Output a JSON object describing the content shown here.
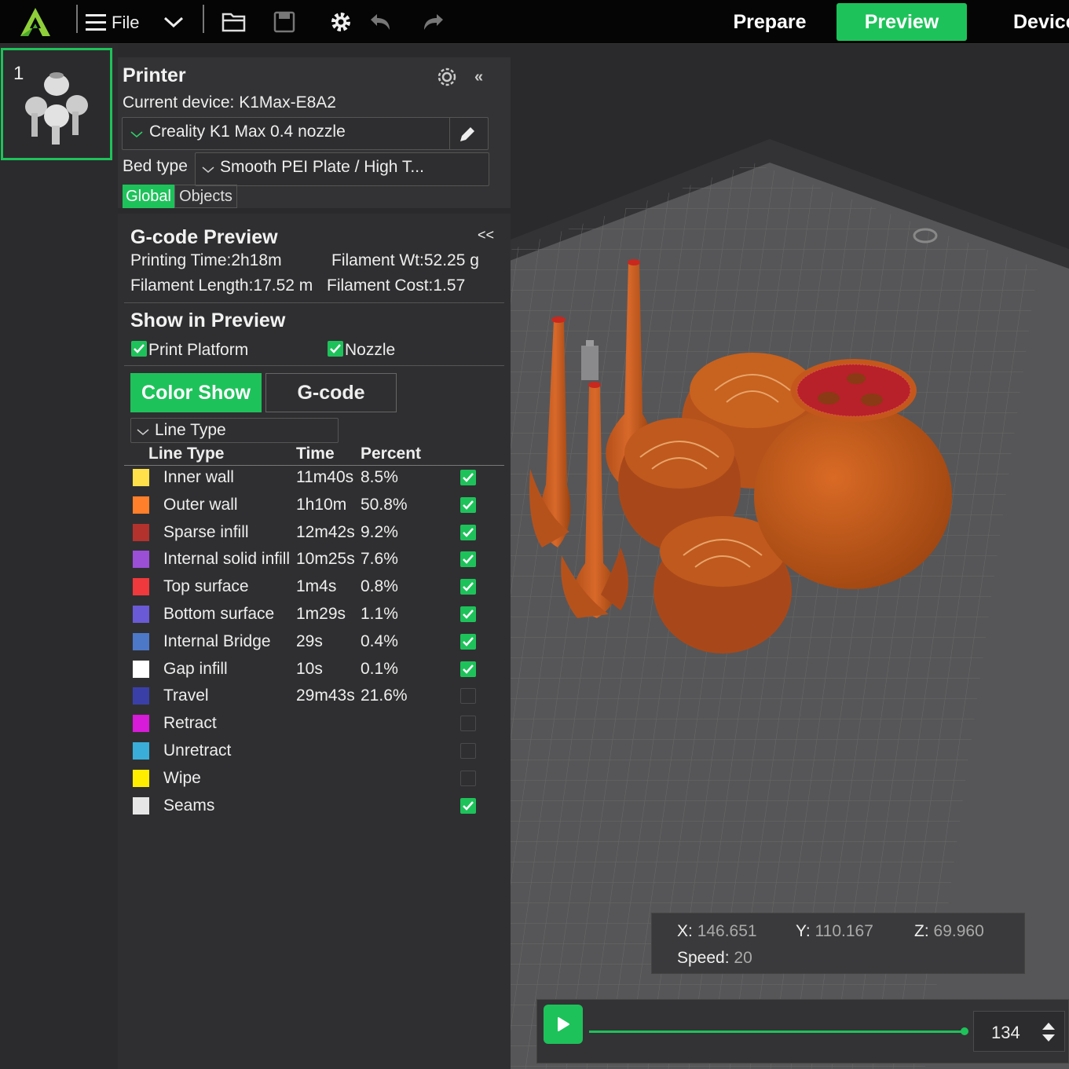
{
  "toolbar": {
    "file_label": "File",
    "nav_prepare": "Prepare",
    "nav_preview": "Preview",
    "nav_device": "Device"
  },
  "plate": {
    "number": "1"
  },
  "printer": {
    "title": "Printer",
    "current_device": "Current device: K1Max-E8A2",
    "printer_profile": "Creality K1 Max 0.4 nozzle",
    "bed_type_label": "Bed type",
    "bed_type_value": "Smooth PEI Plate / High T...",
    "tab_global": "Global",
    "tab_objects": "Objects"
  },
  "gcode_preview": {
    "title": "G-code Preview",
    "collapse_label": "<<",
    "printing_time": "Printing Time:2h18m",
    "filament_wt": "Filament Wt:52.25 g",
    "filament_length": "Filament Length:17.52 m",
    "filament_cost": "Filament Cost:1.57",
    "show_title": "Show in Preview",
    "print_platform": "Print Platform",
    "nozzle": "Nozzle",
    "color_show": "Color Show",
    "gcode_btn": "G-code",
    "view_mode": "Line Type",
    "col_line_type": "Line Type",
    "col_time": "Time",
    "col_percent": "Percent",
    "line_types": [
      {
        "name": "Inner wall",
        "time": "11m40s",
        "percent": "8.5%",
        "color": "#ffe04a",
        "checked": true
      },
      {
        "name": "Outer wall",
        "time": "1h10m",
        "percent": "50.8%",
        "color": "#ff7f2a",
        "checked": true
      },
      {
        "name": "Sparse infill",
        "time": "12m42s",
        "percent": "9.2%",
        "color": "#b3322d",
        "checked": true
      },
      {
        "name": "Internal solid infill",
        "time": "10m25s",
        "percent": "7.6%",
        "color": "#9b4fd6",
        "checked": true
      },
      {
        "name": "Top surface",
        "time": "1m4s",
        "percent": "0.8%",
        "color": "#f0393c",
        "checked": true
      },
      {
        "name": "Bottom surface",
        "time": "1m29s",
        "percent": "1.1%",
        "color": "#6a5ad6",
        "checked": true
      },
      {
        "name": "Internal Bridge",
        "time": "29s",
        "percent": "0.4%",
        "color": "#4d78c8",
        "checked": true
      },
      {
        "name": "Gap infill",
        "time": "10s",
        "percent": "0.1%",
        "color": "#ffffff",
        "checked": true
      },
      {
        "name": "Travel",
        "time": "29m43s",
        "percent": "21.6%",
        "color": "#3a3fa8",
        "checked": false
      },
      {
        "name": "Retract",
        "time": "",
        "percent": "",
        "color": "#d81bd8",
        "checked": false
      },
      {
        "name": "Unretract",
        "time": "",
        "percent": "",
        "color": "#3aaed8",
        "checked": false
      },
      {
        "name": "Wipe",
        "time": "",
        "percent": "",
        "color": "#ffee00",
        "checked": false
      },
      {
        "name": "Seams",
        "time": "",
        "percent": "",
        "color": "#e6e6e6",
        "checked": true
      }
    ]
  },
  "coords": {
    "x_label": "X:",
    "x_value": "146.651",
    "y_label": "Y:",
    "y_value": "110.167",
    "z_label": "Z:",
    "z_value": "69.960",
    "speed_label": "Speed:",
    "speed_value": "20"
  },
  "slider": {
    "layer_value": "134"
  },
  "colors": {
    "accent": "#1ec25a",
    "model": "#c65a1a"
  }
}
